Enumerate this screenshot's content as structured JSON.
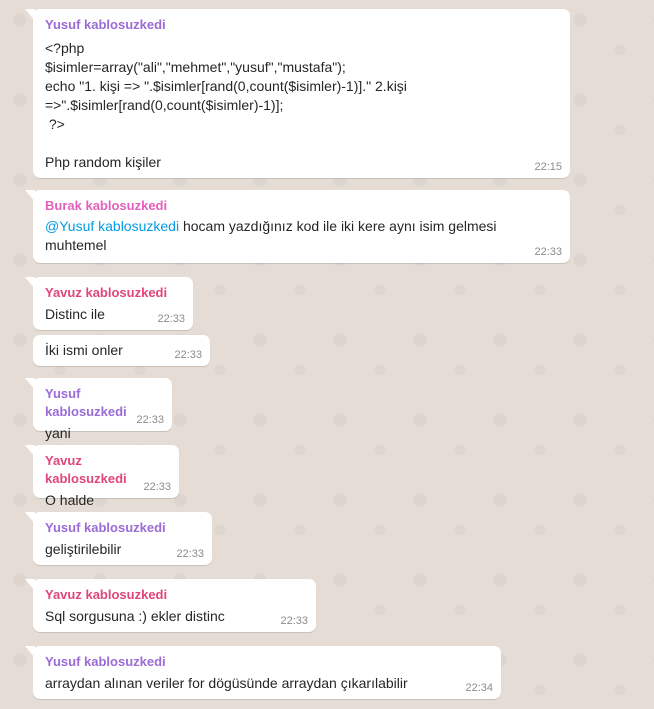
{
  "colors": {
    "yusuf": "#9b6bd6",
    "burak": "#e35fbd",
    "yavuz": "#e0457c",
    "mention": "#039be5",
    "background": "#e5ddd5"
  },
  "messages": [
    {
      "sender": "Yusuf kablosuzkedi",
      "text": "<?php\n$isimler=array(\"ali\",\"mehmet\",\"yusuf\",\"mustafa\");\necho \"1. kişi => \".$isimler[rand(0,count($isimler)-1)].\" 2.kişi\n=>\".$isimler[rand(0,count($isimler)-1)];\n ?>\n\nPhp random kişiler",
      "time": "22:15"
    },
    {
      "sender": "Burak kablosuzkedi",
      "mention": "@Yusuf kablosuzkedi",
      "text": " hocam yazdığınız kod ile iki kere aynı isim gelmesi\nmuhtemel",
      "time": "22:33"
    },
    {
      "sender": "Yavuz kablosuzkedi",
      "text": "Distinc ile",
      "time": "22:33"
    },
    {
      "text": "İki ismi onler",
      "time": "22:33"
    },
    {
      "sender": "Yusuf kablosuzkedi",
      "text": "yani",
      "time": "22:33"
    },
    {
      "sender": "Yavuz kablosuzkedi",
      "text": "O halde",
      "time": "22:33"
    },
    {
      "sender": "Yusuf kablosuzkedi",
      "text": "geliştirilebilir",
      "time": "22:33"
    },
    {
      "sender": "Yavuz kablosuzkedi",
      "text": "Sql sorgusuna :) ekler distinc",
      "time": "22:33"
    },
    {
      "sender": "Yusuf kablosuzkedi",
      "text": "arraydan alınan veriler for dögüsünde arraydan çıkarılabilir",
      "time": "22:34"
    }
  ]
}
